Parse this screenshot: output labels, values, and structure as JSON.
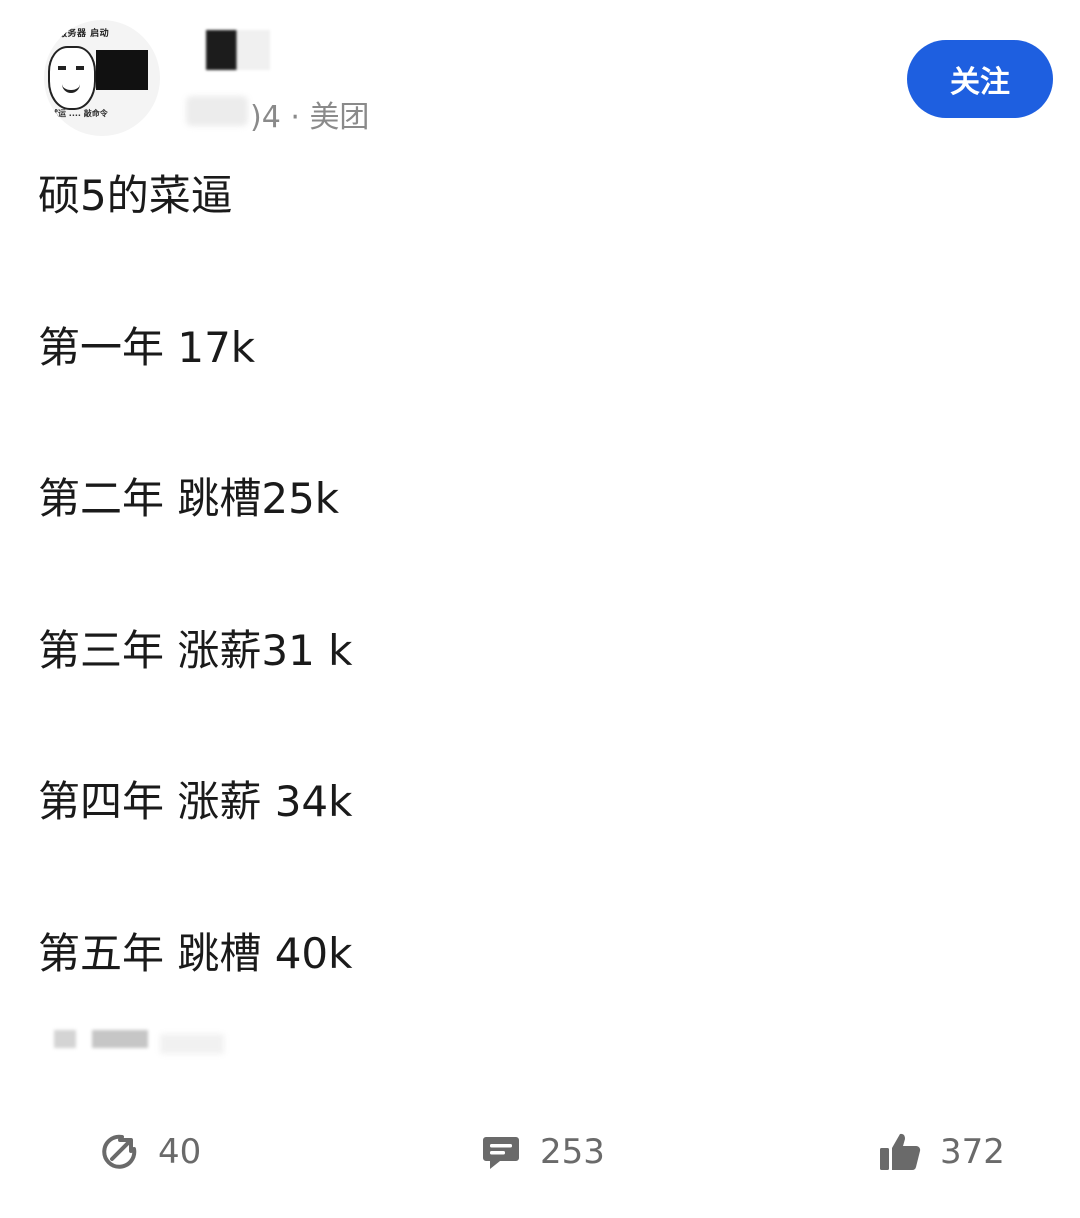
{
  "header": {
    "avatar": {
      "caption_top": "服务器 启动",
      "caption_bottom": "试运 .... 敲命令"
    },
    "meta": {
      "date_partial": ")4",
      "separator": "·",
      "company": "美团"
    },
    "follow_label": "关注",
    "colors": {
      "follow_bg": "#1e5fe0",
      "follow_text": "#ffffff",
      "meta_text": "#8a8a8a"
    }
  },
  "post": {
    "lines": [
      "硕5的菜逼",
      "第一年 17k",
      "第二年 跳槽25k",
      "第三年 涨薪31 k",
      "第四年 涨薪 34k",
      "第五年 跳槽 40k"
    ]
  },
  "actions": {
    "share": {
      "icon": "share-icon",
      "count": "40"
    },
    "comment": {
      "icon": "comment-icon",
      "count": "253"
    },
    "like": {
      "icon": "thumbs-up-icon",
      "count": "372"
    }
  }
}
